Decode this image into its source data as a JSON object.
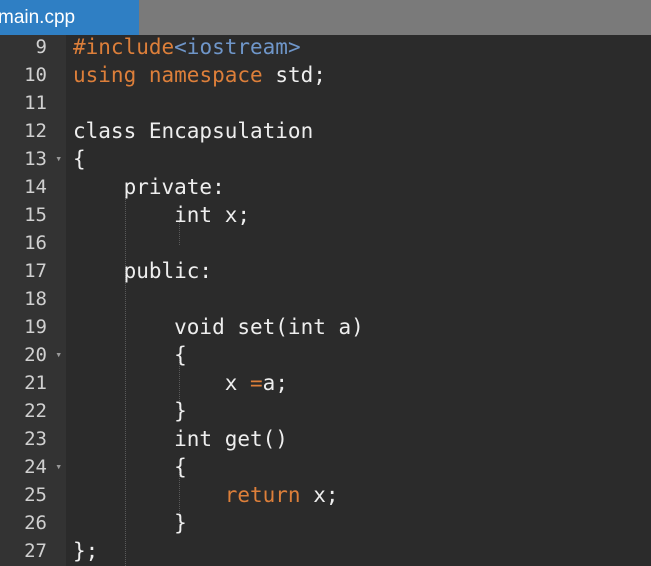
{
  "tab": {
    "filename": "main.cpp"
  },
  "lines": [
    {
      "num": "9",
      "fold": "",
      "parts": [
        {
          "t": "#include",
          "c": "kw-orange"
        },
        {
          "t": "<iostream>",
          "c": "kw-blue"
        }
      ]
    },
    {
      "num": "10",
      "fold": "",
      "parts": [
        {
          "t": "using",
          "c": "kw-orange"
        },
        {
          "t": " ",
          "c": "plain"
        },
        {
          "t": "namespace",
          "c": "kw-orange"
        },
        {
          "t": " std;",
          "c": "plain"
        }
      ]
    },
    {
      "num": "11",
      "fold": "",
      "parts": []
    },
    {
      "num": "12",
      "fold": "",
      "parts": [
        {
          "t": "class Encapsulation",
          "c": "plain"
        }
      ]
    },
    {
      "num": "13",
      "fold": "▾",
      "parts": [
        {
          "t": "{",
          "c": "plain"
        }
      ]
    },
    {
      "num": "14",
      "fold": "",
      "parts": [
        {
          "t": "    private:",
          "c": "plain"
        }
      ]
    },
    {
      "num": "15",
      "fold": "",
      "parts": [
        {
          "t": "        int x;",
          "c": "plain"
        }
      ]
    },
    {
      "num": "16",
      "fold": "",
      "parts": []
    },
    {
      "num": "17",
      "fold": "",
      "parts": [
        {
          "t": "    public:",
          "c": "plain"
        }
      ]
    },
    {
      "num": "18",
      "fold": "",
      "parts": []
    },
    {
      "num": "19",
      "fold": "",
      "parts": [
        {
          "t": "        void set(int a)",
          "c": "plain"
        }
      ]
    },
    {
      "num": "20",
      "fold": "▾",
      "parts": [
        {
          "t": "        {",
          "c": "plain"
        }
      ]
    },
    {
      "num": "21",
      "fold": "",
      "parts": [
        {
          "t": "            x ",
          "c": "plain"
        },
        {
          "t": "=",
          "c": "op"
        },
        {
          "t": "a;",
          "c": "plain"
        }
      ]
    },
    {
      "num": "22",
      "fold": "",
      "parts": [
        {
          "t": "        }",
          "c": "plain"
        }
      ]
    },
    {
      "num": "23",
      "fold": "",
      "parts": [
        {
          "t": "        int get()",
          "c": "plain"
        }
      ]
    },
    {
      "num": "24",
      "fold": "▾",
      "parts": [
        {
          "t": "        {",
          "c": "plain"
        }
      ]
    },
    {
      "num": "25",
      "fold": "",
      "parts": [
        {
          "t": "            ",
          "c": "plain"
        },
        {
          "t": "return",
          "c": "kw-orange"
        },
        {
          "t": " x;",
          "c": "plain"
        }
      ]
    },
    {
      "num": "26",
      "fold": "",
      "parts": [
        {
          "t": "        }",
          "c": "plain"
        }
      ]
    },
    {
      "num": "27",
      "fold": "",
      "parts": [
        {
          "t": "};",
          "c": "plain"
        }
      ]
    }
  ]
}
